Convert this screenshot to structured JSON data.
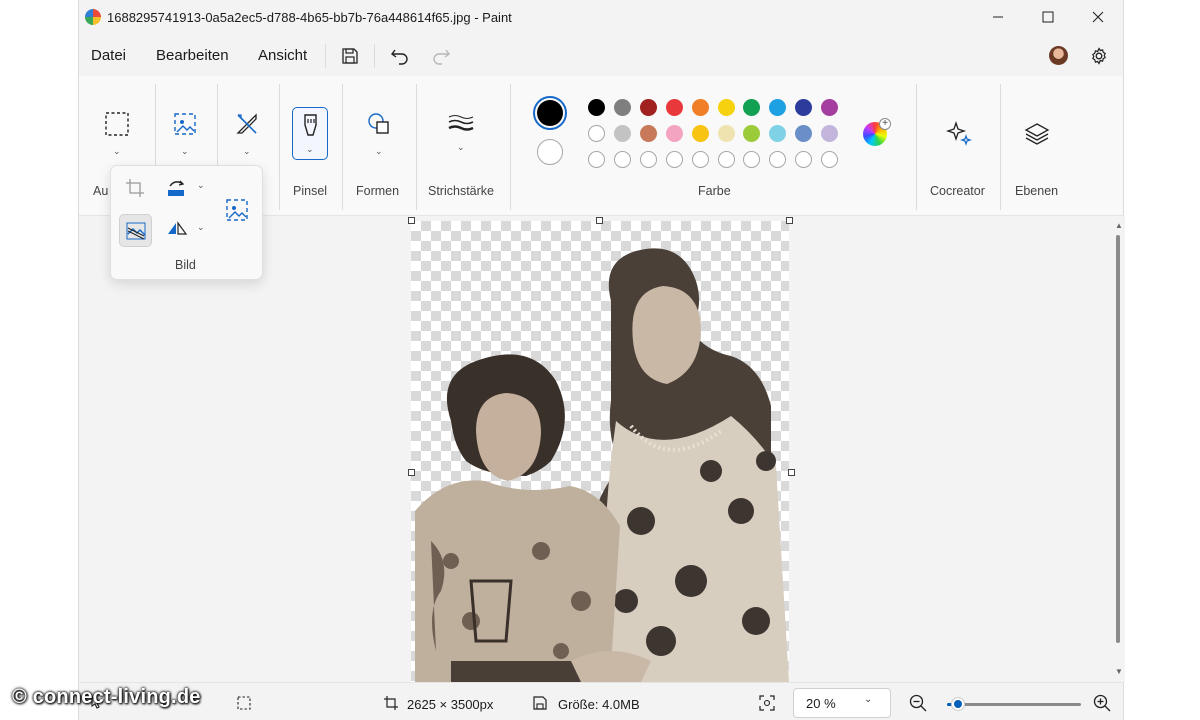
{
  "window": {
    "title": "1688295741913-0a5a2ec5-d788-4b65-bb7b-76a448614f65.jpg - Paint",
    "minimize_icon": "minimize-icon",
    "maximize_icon": "maximize-icon",
    "close_icon": "close-icon"
  },
  "menu": {
    "items": [
      "Datei",
      "Bearbeiten",
      "Ansicht"
    ]
  },
  "ribbon": {
    "groups": {
      "auswahl": "Au",
      "pinsel": "Pinsel",
      "formen": "Formen",
      "strichstaerke": "Strichstärke",
      "farbe": "Farbe",
      "cocreator": "Cocreator",
      "ebenen": "Ebenen"
    },
    "primary_color": "#000000",
    "secondary_color": "#ffffff",
    "palette_row1": [
      "#000000",
      "#7f7f7f",
      "#a12020",
      "#e8383c",
      "#f07f27",
      "#f5d20d",
      "#12a152",
      "#1da1e2",
      "#2d3c9c",
      "#a43f9f"
    ],
    "palette_row2": [
      "#ffffff",
      "#c3c3c3",
      "#c8795a",
      "#f3a4c0",
      "#f7c414",
      "#efe3b0",
      "#9ccb3a",
      "#7fd2e6",
      "#6a8fc8",
      "#c3b5dc"
    ]
  },
  "flyout": {
    "label": "Bild"
  },
  "status": {
    "dimensions": "2625 × 3500px",
    "size": "Größe: 4.0MB",
    "zoom": "20 %",
    "zoom_level": 0.08
  },
  "watermark": "© connect-living.de"
}
